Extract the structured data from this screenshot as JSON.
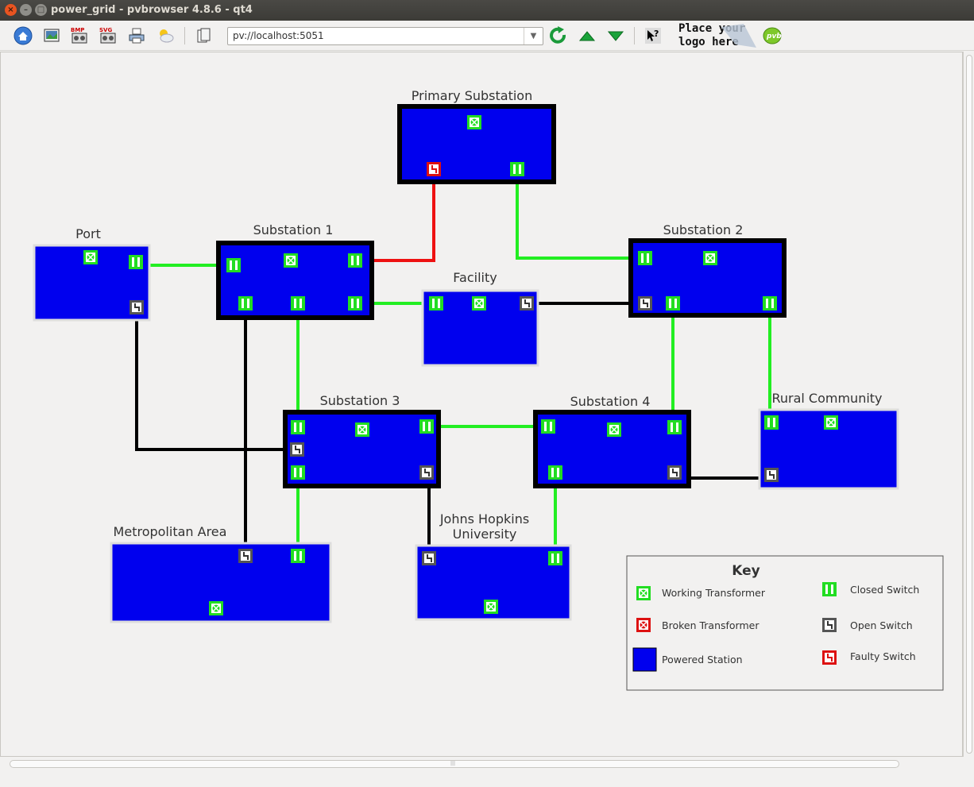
{
  "window": {
    "title": "power_grid - pvbrowser 4.8.6 - qt4"
  },
  "toolbar": {
    "url": "pv://localhost:5051",
    "logo_line1": "Place your",
    "logo_line2": "logo here",
    "icons": [
      "home-icon",
      "screenshot-icon",
      "bmp-icon",
      "svg-icon",
      "print-icon",
      "weather-icon",
      "copy-icon",
      "reload-icon",
      "arrow-up-icon",
      "arrow-down-icon",
      "whats-this-icon",
      "pvb-icon"
    ]
  },
  "diagram": {
    "stations": {
      "primary": "Primary Substation",
      "port": "Port",
      "sub1": "Substation 1",
      "sub2": "Substation 2",
      "facility": "Facility",
      "sub3": "Substation 3",
      "sub4": "Substation 4",
      "rural": "Rural Community",
      "metro": "Metropolitan Area",
      "jhu_line1": "Johns Hopkins",
      "jhu_line2": "University"
    },
    "legend": {
      "title": "Key",
      "working_transformer": "Working Transformer",
      "broken_transformer": "Broken Transformer",
      "powered_station": "Powered Station",
      "closed_switch": "Closed Switch",
      "open_switch": "Open Switch",
      "faulty_switch": "Faulty Switch"
    },
    "colors": {
      "station_fill": "#0000ee",
      "working": "#22dd22",
      "broken": "#dd1111",
      "open": "#555555",
      "line_closed": "#22ee22",
      "line_open": "#000000",
      "line_faulty": "#ee1111"
    }
  }
}
